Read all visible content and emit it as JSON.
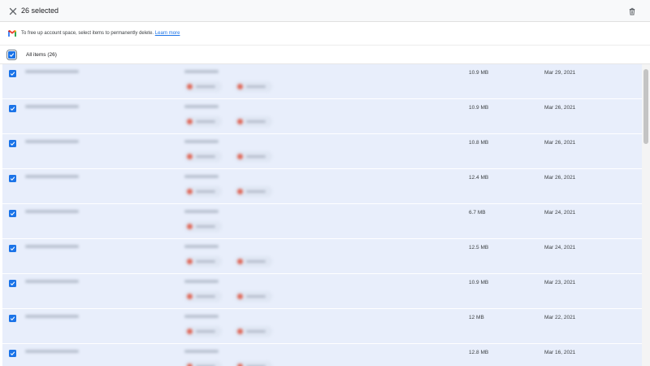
{
  "topbar": {
    "selected_text": "26 selected"
  },
  "info": {
    "text": "To free up account space, select items to permanently delete.",
    "link": "Learn more"
  },
  "list_header": {
    "label": "All items (26)"
  },
  "colors": {
    "accent": "#1a73e8",
    "row_selected": "#e8eefb",
    "chip_dot": "#e06a5a"
  },
  "rows": [
    {
      "size": "10.9 MB",
      "date": "Mar 29, 2021",
      "attachments": 2
    },
    {
      "size": "10.9 MB",
      "date": "Mar 26, 2021",
      "attachments": 2
    },
    {
      "size": "10.8 MB",
      "date": "Mar 26, 2021",
      "attachments": 2
    },
    {
      "size": "12.4 MB",
      "date": "Mar 26, 2021",
      "attachments": 2
    },
    {
      "size": "6.7 MB",
      "date": "Mar 24, 2021",
      "attachments": 1
    },
    {
      "size": "12.5 MB",
      "date": "Mar 24, 2021",
      "attachments": 2
    },
    {
      "size": "10.9 MB",
      "date": "Mar 23, 2021",
      "attachments": 2
    },
    {
      "size": "12 MB",
      "date": "Mar 22, 2021",
      "attachments": 2
    },
    {
      "size": "12.8 MB",
      "date": "Mar 16, 2021",
      "attachments": 2
    }
  ]
}
